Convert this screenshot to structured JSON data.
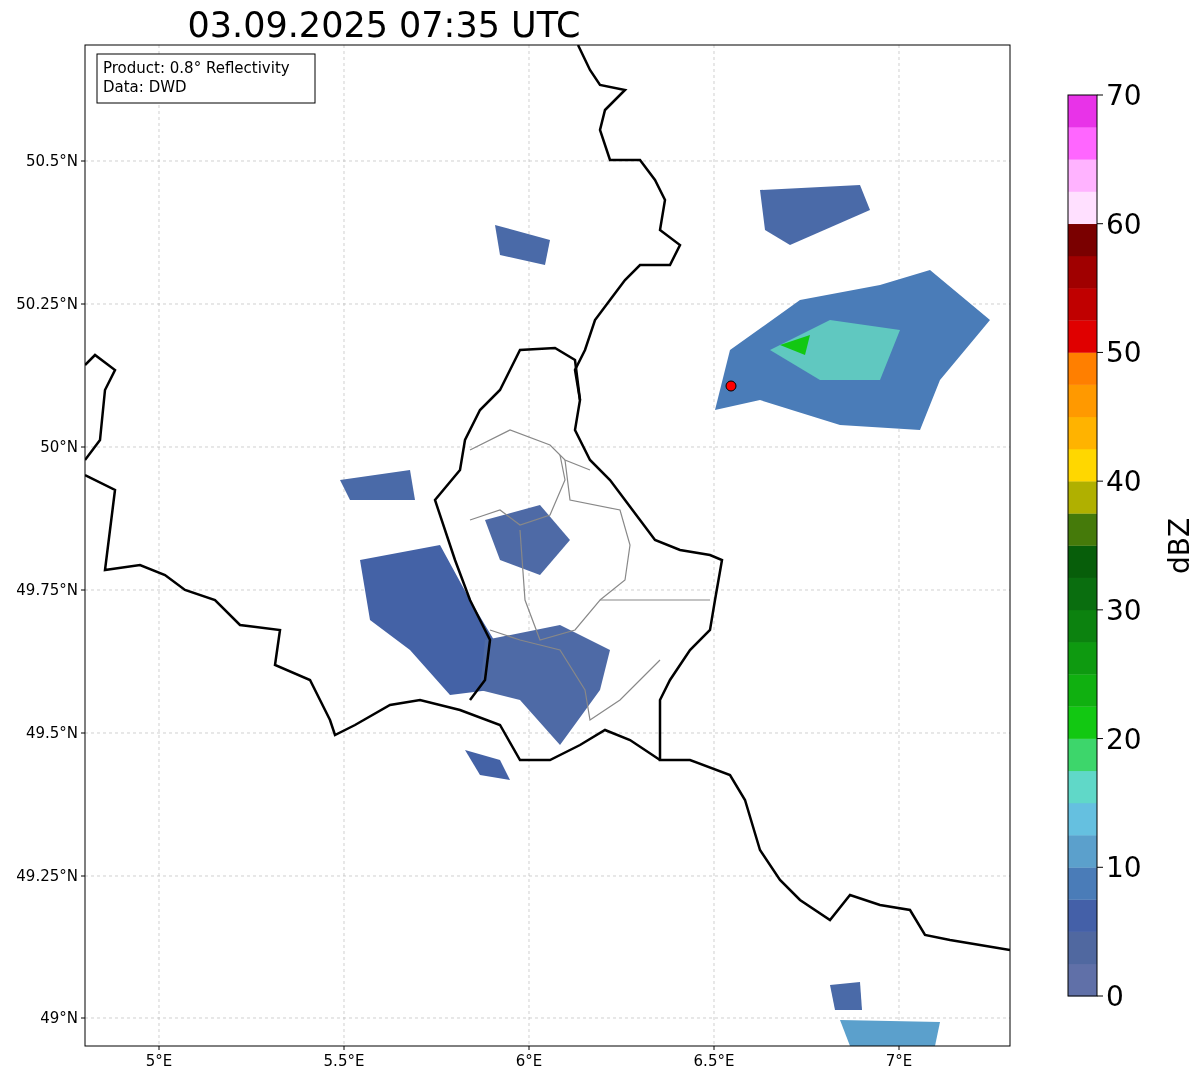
{
  "title": "03.09.2025 07:35 UTC",
  "map": {
    "legend": [
      "Product: 0.8° Reflectivity",
      "Data: DWD"
    ],
    "xticks": [
      "5°E",
      "5.5°E",
      "6°E",
      "6.5°E",
      "7°E"
    ],
    "yticks": [
      "50.5°N",
      "50.25°N",
      "50°N",
      "49.75°N",
      "49.5°N",
      "49.25°N",
      "49°N"
    ]
  },
  "colorbar": {
    "label": "dBZ",
    "ticks": [
      "70",
      "60",
      "50",
      "40",
      "30",
      "20",
      "10",
      "0"
    ],
    "bins": [
      {
        "color": "#6070a8"
      },
      {
        "color": "#5068a0"
      },
      {
        "color": "#4460a8"
      },
      {
        "color": "#4a7cb8"
      },
      {
        "color": "#5ba0cc"
      },
      {
        "color": "#65c0e0"
      },
      {
        "color": "#60d8c8"
      },
      {
        "color": "#3dd66b"
      },
      {
        "color": "#12c812"
      },
      {
        "color": "#10b010"
      },
      {
        "color": "#0e9a10"
      },
      {
        "color": "#0c820f"
      },
      {
        "color": "#0a6e0f"
      },
      {
        "color": "#075e0a"
      },
      {
        "color": "#457a0a"
      },
      {
        "color": "#b0b000"
      },
      {
        "color": "#ffd700"
      },
      {
        "color": "#ffb300"
      },
      {
        "color": "#ff9900"
      },
      {
        "color": "#ff7f00"
      },
      {
        "color": "#e00000"
      },
      {
        "color": "#c00000"
      },
      {
        "color": "#a00000"
      },
      {
        "color": "#7a0000"
      },
      {
        "color": "#ffe0ff"
      },
      {
        "color": "#ffb3ff"
      },
      {
        "color": "#ff66ff"
      },
      {
        "color": "#e833e8"
      }
    ]
  }
}
